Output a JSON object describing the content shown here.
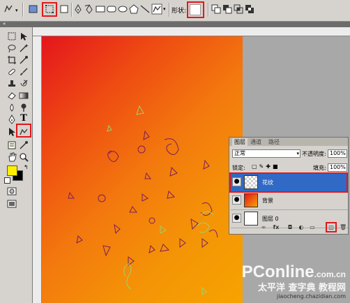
{
  "options_bar": {
    "shape_label": "形状:",
    "tools": [
      "pen-tool-icon",
      "pen-freeform-icon",
      "rectangle-icon",
      "rounded-rectangle-icon",
      "ellipse-icon",
      "polygon-icon",
      "line-icon",
      "custom-shape-icon"
    ]
  },
  "layers_panel": {
    "tabs": [
      "图层",
      "通道",
      "路径"
    ],
    "blend_mode": "正常",
    "opacity_label": "不透明度:",
    "opacity_value": "100%",
    "lock_label": "锁定:",
    "fill_label": "填充:",
    "fill_value": "100%",
    "layers": [
      {
        "name": "花纹",
        "selected": true
      },
      {
        "name": "背景",
        "selected": false
      },
      {
        "name": "图层 0",
        "selected": false
      }
    ],
    "bottom_icons": [
      "link-icon",
      "fx-icon",
      "mask-icon",
      "adjustment-icon",
      "group-icon",
      "new-layer-icon",
      "trash-icon"
    ]
  },
  "watermark": {
    "brand": "PConline",
    "brand_suffix": ".com.cn",
    "sub": "太平洋 查字典 教程网",
    "url": "jiaocheng.chazidian.com"
  },
  "colors": {
    "highlight": "#e0181c",
    "selected_layer": "#3169c6",
    "foreground": "#ffee00",
    "background": "#000000"
  }
}
